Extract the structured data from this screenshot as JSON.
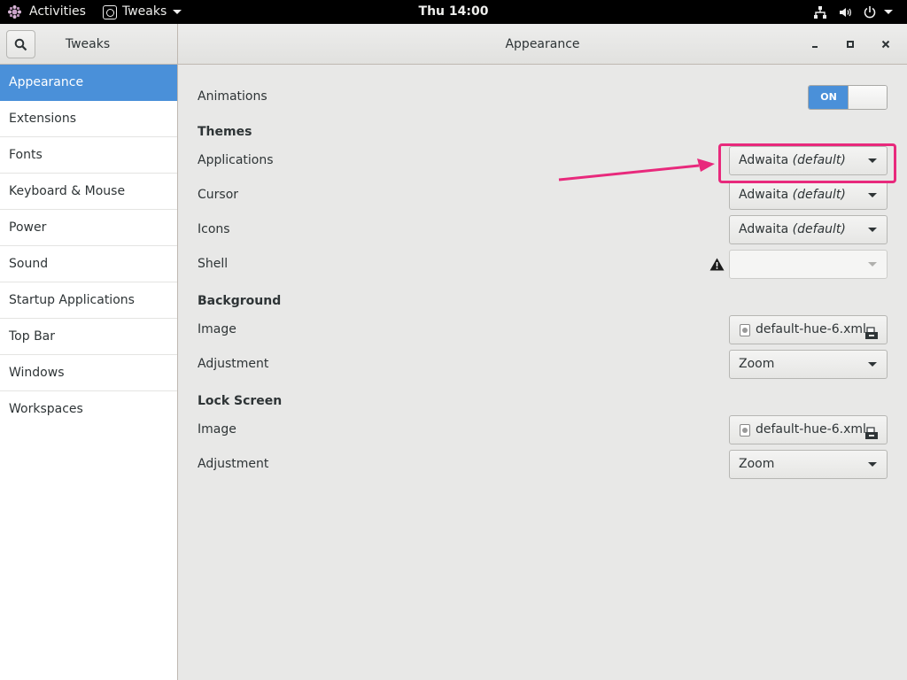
{
  "topbar": {
    "activities": "Activities",
    "app_name": "Tweaks",
    "clock": "Thu 14:00",
    "icons": [
      "network-icon",
      "volume-icon",
      "power-icon"
    ]
  },
  "window": {
    "sidebar_title": "Tweaks",
    "title": "Appearance",
    "controls": [
      "minimize-icon",
      "maximize-icon",
      "close-icon"
    ]
  },
  "sidebar": {
    "items": [
      {
        "label": "Appearance",
        "active": true
      },
      {
        "label": "Extensions"
      },
      {
        "label": "Fonts"
      },
      {
        "label": "Keyboard & Mouse"
      },
      {
        "label": "Power"
      },
      {
        "label": "Sound"
      },
      {
        "label": "Startup Applications"
      },
      {
        "label": "Top Bar"
      },
      {
        "label": "Windows"
      },
      {
        "label": "Workspaces"
      }
    ]
  },
  "content": {
    "animations": {
      "label": "Animations",
      "state": "ON"
    },
    "themes": {
      "title": "Themes",
      "applications": {
        "label": "Applications",
        "value": "Adwaita",
        "suffix": "(default)"
      },
      "cursor": {
        "label": "Cursor",
        "value": "Adwaita",
        "suffix": "(default)"
      },
      "icons": {
        "label": "Icons",
        "value": "Adwaita",
        "suffix": "(default)"
      },
      "shell": {
        "label": "Shell",
        "value": "",
        "warning": true
      }
    },
    "background": {
      "title": "Background",
      "image": {
        "label": "Image",
        "value": "default-hue-6.xml"
      },
      "adjustment": {
        "label": "Adjustment",
        "value": "Zoom"
      }
    },
    "lock_screen": {
      "title": "Lock Screen",
      "image": {
        "label": "Image",
        "value": "default-hue-6.xml"
      },
      "adjustment": {
        "label": "Adjustment",
        "value": "Zoom"
      }
    }
  },
  "annotation": {
    "color": "#e8297c"
  },
  "colors": {
    "accent": "#4a90d9",
    "topbar": "#000000",
    "window_bg": "#e8e8e7"
  }
}
